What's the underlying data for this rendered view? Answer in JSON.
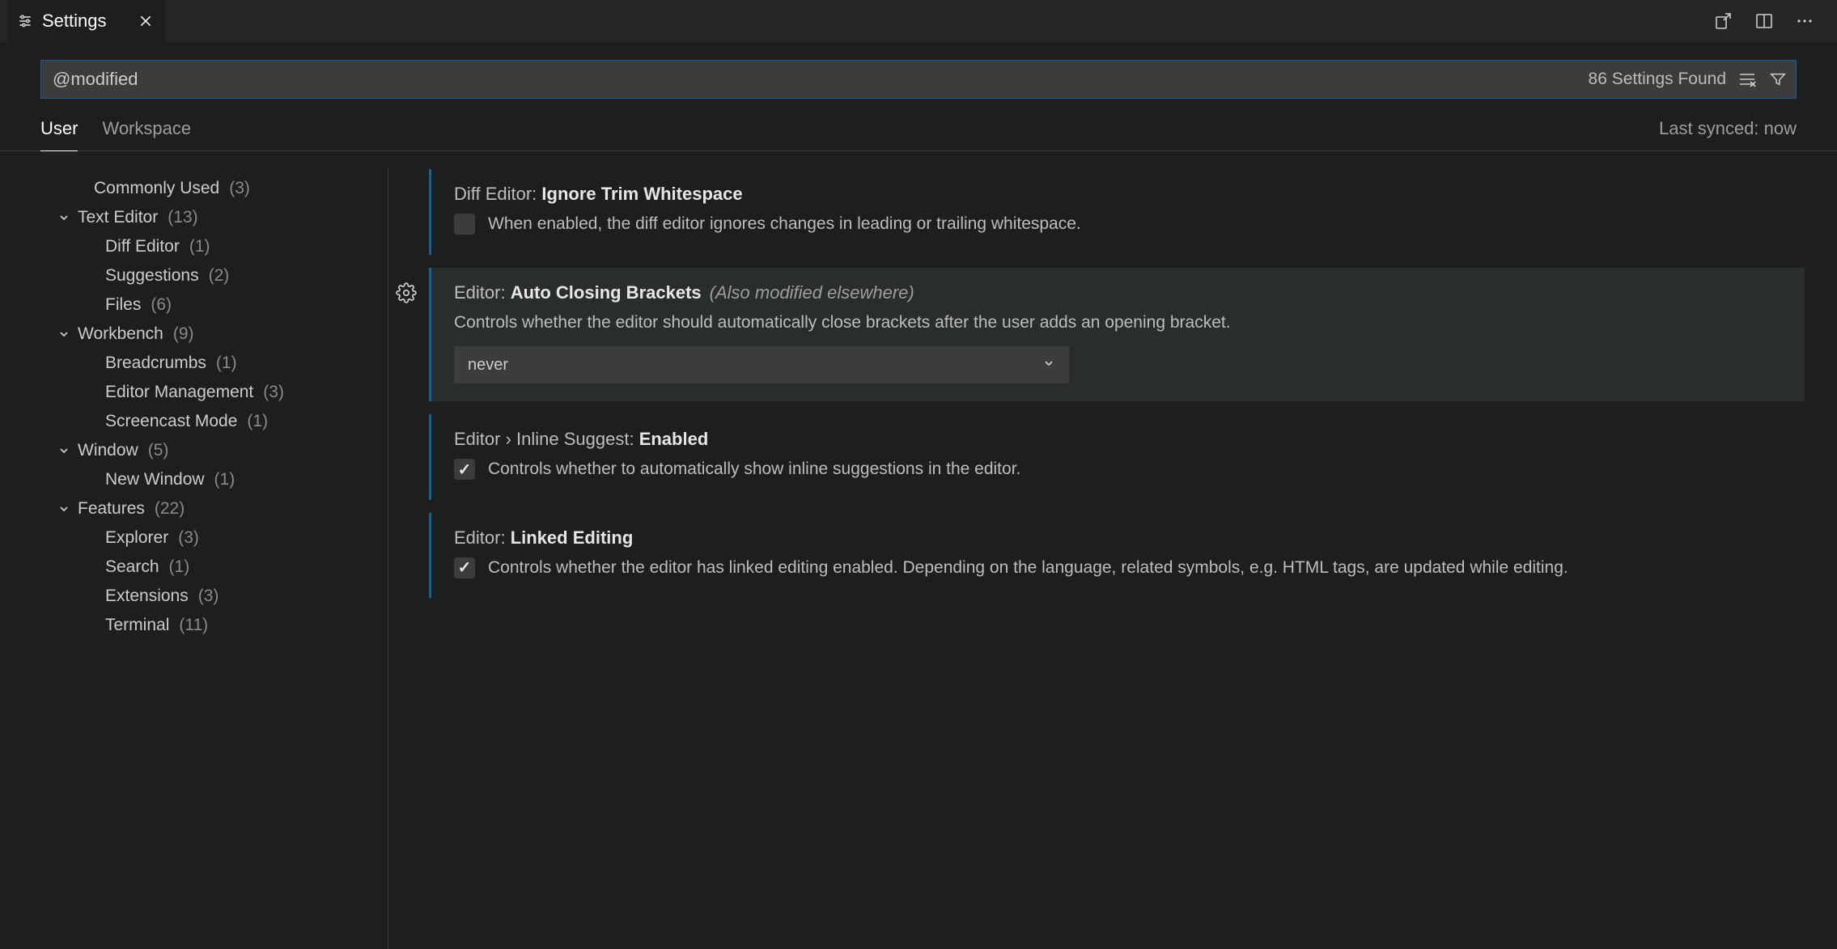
{
  "tab": {
    "title": "Settings"
  },
  "search": {
    "value": "@modified ",
    "count_text": "86 Settings Found"
  },
  "scope": {
    "tabs": [
      "User",
      "Workspace"
    ],
    "active": 0,
    "sync_status": "Last synced: now"
  },
  "tree": [
    {
      "label": "Commonly Used",
      "count": "(3)",
      "indent": 0,
      "chevron": false
    },
    {
      "label": "Text Editor",
      "count": "(13)",
      "indent": 1,
      "chevron": true
    },
    {
      "label": "Diff Editor",
      "count": "(1)",
      "indent": 2,
      "chevron": false
    },
    {
      "label": "Suggestions",
      "count": "(2)",
      "indent": 2,
      "chevron": false
    },
    {
      "label": "Files",
      "count": "(6)",
      "indent": 2,
      "chevron": false
    },
    {
      "label": "Workbench",
      "count": "(9)",
      "indent": 1,
      "chevron": true
    },
    {
      "label": "Breadcrumbs",
      "count": "(1)",
      "indent": 2,
      "chevron": false
    },
    {
      "label": "Editor Management",
      "count": "(3)",
      "indent": 2,
      "chevron": false
    },
    {
      "label": "Screencast Mode",
      "count": "(1)",
      "indent": 2,
      "chevron": false
    },
    {
      "label": "Window",
      "count": "(5)",
      "indent": 1,
      "chevron": true
    },
    {
      "label": "New Window",
      "count": "(1)",
      "indent": 2,
      "chevron": false
    },
    {
      "label": "Features",
      "count": "(22)",
      "indent": 1,
      "chevron": true
    },
    {
      "label": "Explorer",
      "count": "(3)",
      "indent": 2,
      "chevron": false
    },
    {
      "label": "Search",
      "count": "(1)",
      "indent": 2,
      "chevron": false
    },
    {
      "label": "Extensions",
      "count": "(3)",
      "indent": 2,
      "chevron": false
    },
    {
      "label": "Terminal",
      "count": "(11)",
      "indent": 2,
      "chevron": false
    }
  ],
  "settings": [
    {
      "prefix": "Diff Editor: ",
      "name": "Ignore Trim Whitespace",
      "elsewhere": "",
      "type": "checkbox",
      "checked": false,
      "desc": "When enabled, the diff editor ignores changes in leading or trailing whitespace.",
      "active": false
    },
    {
      "prefix": "Editor: ",
      "name": "Auto Closing Brackets",
      "elsewhere": "(Also modified elsewhere)",
      "type": "select",
      "value": "never",
      "desc": "Controls whether the editor should automatically close brackets after the user adds an opening bracket.",
      "active": true
    },
    {
      "prefix": "Editor › Inline Suggest: ",
      "name": "Enabled",
      "elsewhere": "",
      "type": "checkbox",
      "checked": true,
      "desc": "Controls whether to automatically show inline suggestions in the editor.",
      "active": false
    },
    {
      "prefix": "Editor: ",
      "name": "Linked Editing",
      "elsewhere": "",
      "type": "checkbox",
      "checked": true,
      "desc": "Controls whether the editor has linked editing enabled. Depending on the language, related symbols, e.g. HTML tags, are updated while editing.",
      "active": false
    }
  ]
}
